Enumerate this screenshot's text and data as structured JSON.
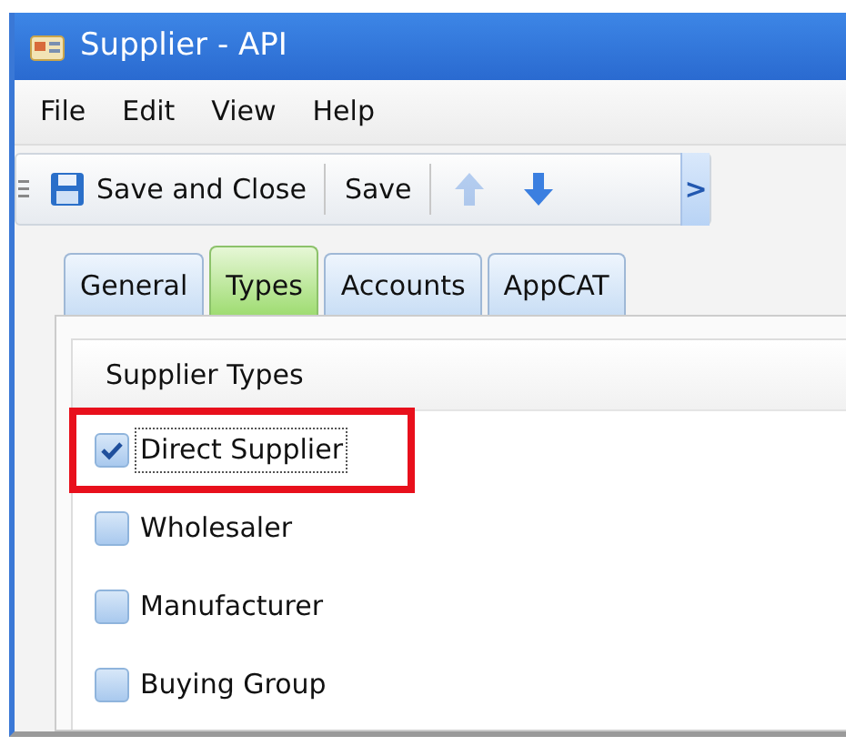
{
  "window": {
    "title": "Supplier - API"
  },
  "menu": [
    "File",
    "Edit",
    "View",
    "Help"
  ],
  "toolbar": [
    {
      "kind": "save-close",
      "label": "Save and Close",
      "disabled": false
    },
    {
      "kind": "separator"
    },
    {
      "kind": "text",
      "label": "Save",
      "disabled": false
    },
    {
      "kind": "separator"
    },
    {
      "kind": "up",
      "disabled": true
    },
    {
      "kind": "down",
      "disabled": false
    },
    {
      "kind": "overflow",
      "label": ">",
      "disabled": false
    }
  ],
  "tabs": [
    {
      "label": "General",
      "selected": false
    },
    {
      "label": "Types",
      "selected": true
    },
    {
      "label": "Accounts",
      "selected": false
    },
    {
      "label": "AppCAT",
      "selected": false
    }
  ],
  "group": {
    "title": "Supplier Types",
    "items": [
      {
        "label": "Direct Supplier",
        "checked": true,
        "focused": true,
        "highlighted": true
      },
      {
        "label": "Wholesaler",
        "checked": false,
        "focused": false,
        "highlighted": false
      },
      {
        "label": "Manufacturer",
        "checked": false,
        "focused": false,
        "highlighted": false
      },
      {
        "label": "Buying Group",
        "checked": false,
        "focused": false,
        "highlighted": false
      }
    ]
  }
}
